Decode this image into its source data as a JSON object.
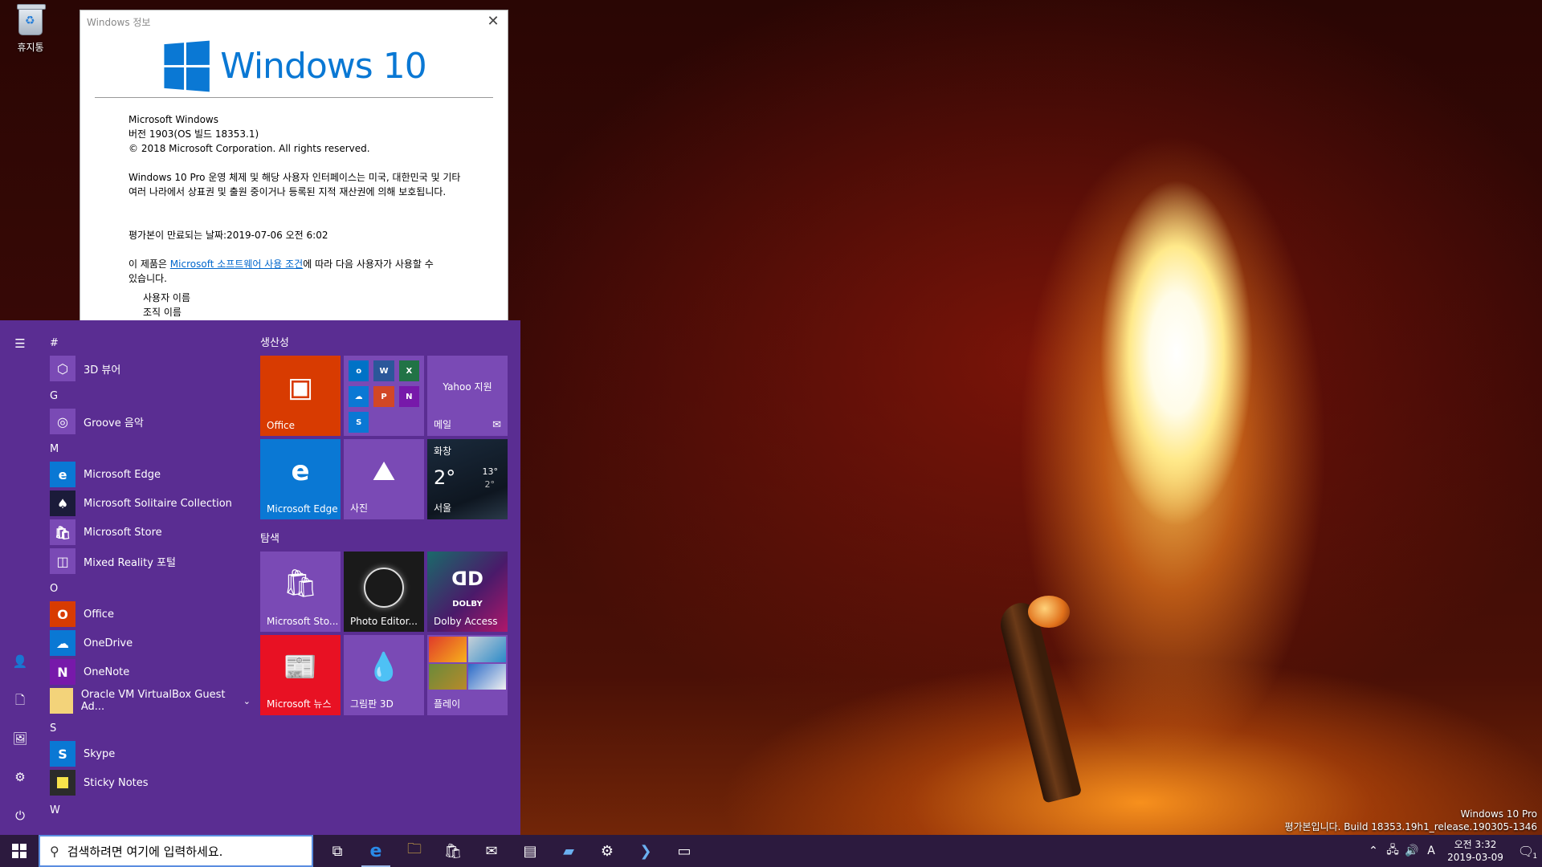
{
  "desktop": {
    "recycle_bin_label": "휴지통",
    "watermark_line1": "Windows 10 Pro",
    "watermark_line2": "평가본입니다. Build 18353.19h1_release.190305-1346"
  },
  "winver": {
    "title": "Windows 정보",
    "close_glyph": "✕",
    "brand": "Windows 10",
    "product": "Microsoft Windows",
    "version": "버전 1903(OS 빌드 18353.1)",
    "copyright": "© 2018 Microsoft Corporation. All rights reserved.",
    "legal": "Windows 10 Pro 운영 체제 및 해당 사용자 인터페이스는 미국, 대한민국 및 기타 여러 나라에서 상표권 및 출원 중이거나 등록된 지적 재산권에 의해 보호됩니다.",
    "expiry": "평가본이 만료되는 날짜:2019-07-06 오전 6:02",
    "license_prefix": "이 제품은 ",
    "license_link": "Microsoft 소프트웨어 사용 조건",
    "license_suffix": "에 따라 다음 사용자가 사용할 수 있습니다.",
    "user_name": "사용자 이름",
    "org_name": "조직 이름"
  },
  "start": {
    "rail": {
      "menu_glyph": "☰",
      "user_glyph": "👤",
      "docs_glyph": "🗋",
      "pics_glyph": "🖼",
      "settings_glyph": "⚙",
      "power_glyph": "⏻"
    },
    "app_list": {
      "hdr_hash": "#",
      "app_3d": "3D 뷰어",
      "hdr_g": "G",
      "app_groove": "Groove 음악",
      "hdr_m": "M",
      "app_edge": "Microsoft Edge",
      "app_solitaire": "Microsoft Solitaire Collection",
      "app_store": "Microsoft Store",
      "app_mixed": "Mixed Reality 포털",
      "hdr_o": "O",
      "app_office": "Office",
      "app_onedrive": "OneDrive",
      "app_onenote": "OneNote",
      "app_vbox": "Oracle VM VirtualBox Guest Ad...",
      "hdr_s": "S",
      "app_skype": "Skype",
      "app_sticky": "Sticky Notes",
      "hdr_w": "W"
    },
    "groups": {
      "productivity": "생산성",
      "explore": "탐색"
    },
    "tiles": {
      "office": "Office",
      "yahoo": "Yahoo 지원",
      "mail": "메일",
      "edge": "Microsoft Edge",
      "photos": "사진",
      "weather_condition": "화창",
      "weather_temp": "2°",
      "weather_high": "13°",
      "weather_low": "2°",
      "weather_city": "서울",
      "store": "Microsoft Sto...",
      "photo_editor": "Photo Editor...",
      "dolby": "Dolby Access",
      "dolby_logo": "DOLBY",
      "news": "Microsoft 뉴스",
      "paint3d": "그림판 3D",
      "play": "플레이"
    }
  },
  "taskbar": {
    "search_placeholder": "검색하려면 여기에 입력하세요.",
    "clock_time": "오전 3:32",
    "clock_date": "2019-03-09",
    "ime": "A",
    "notif_count": "1"
  },
  "colors": {
    "start_bg": "#5a2d92",
    "tile_purple": "#7a4ab5",
    "office_orange": "#d83b01",
    "edge_blue": "#0a78d4",
    "news_red": "#e81123",
    "taskbar_bg": "#2c1a3e",
    "win_blue": "#0a78d4"
  }
}
